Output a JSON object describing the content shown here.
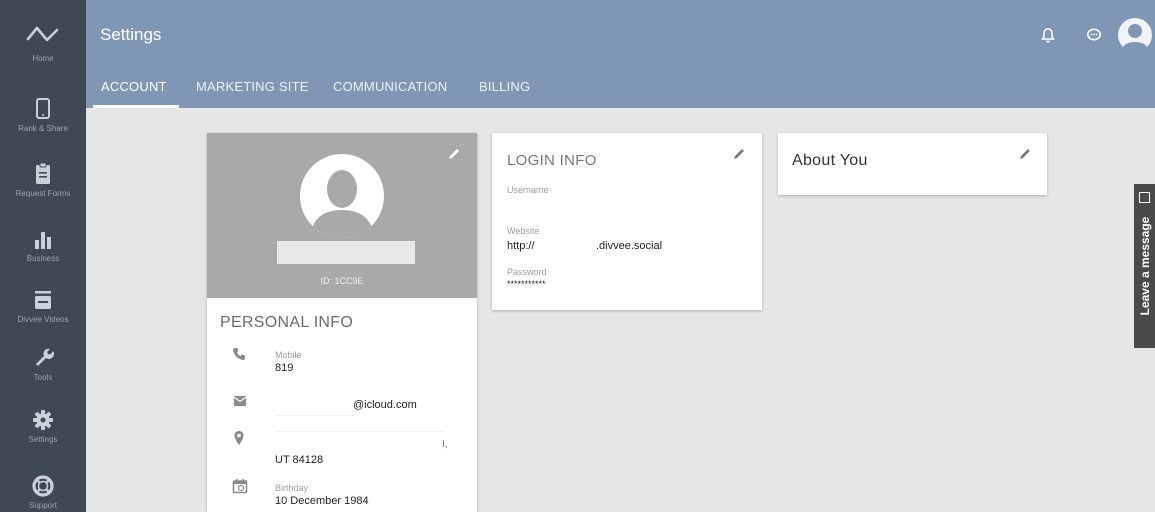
{
  "sidebar": {
    "items": [
      {
        "label": "Home",
        "icon": "pulse-icon"
      },
      {
        "label": "Rank & Share",
        "icon": "phone-icon"
      },
      {
        "label": "Request Forms",
        "icon": "clipboard-icon"
      },
      {
        "label": "Business",
        "icon": "bar-chart-icon"
      },
      {
        "label": "Divvee Videos",
        "icon": "tv-icon"
      },
      {
        "label": "Tools",
        "icon": "wrench-icon"
      },
      {
        "label": "Settings",
        "icon": "gear-icon"
      },
      {
        "label": "Support",
        "icon": "lifebuoy-icon"
      }
    ]
  },
  "header": {
    "title": "Settings",
    "tabs": [
      {
        "label": "ACCOUNT",
        "active": true
      },
      {
        "label": "MARKETING SITE"
      },
      {
        "label": "COMMUNICATION"
      },
      {
        "label": "BILLING"
      }
    ],
    "icons": [
      "bell-icon",
      "chat-icon",
      "user-avatar-icon"
    ]
  },
  "profile": {
    "id_text": "ID: 1CC9E",
    "personal_info_title": "PERSONAL INFO",
    "mobile_label": "Mobile",
    "mobile_value": "819",
    "email_value": "@icloud.com",
    "address_extra": "I,",
    "address_value": "UT 84128",
    "birthday_label": "Birthday",
    "birthday_value": "10 December 1984"
  },
  "login_info": {
    "title": "LOGIN INFO",
    "username_label": "Username",
    "website_label": "Website",
    "website_prefix": "http://",
    "website_suffix": ".divvee.social",
    "password_label": "Password",
    "password_value": "***********"
  },
  "about": {
    "title": "About You"
  },
  "leave_message": {
    "label": "Leave a message"
  },
  "colors": {
    "sidebar_bg": "#3f4956",
    "header_bg": "#7f96b4",
    "content_bg": "#e6e6e6",
    "profile_header_bg": "#a9a9a9"
  }
}
